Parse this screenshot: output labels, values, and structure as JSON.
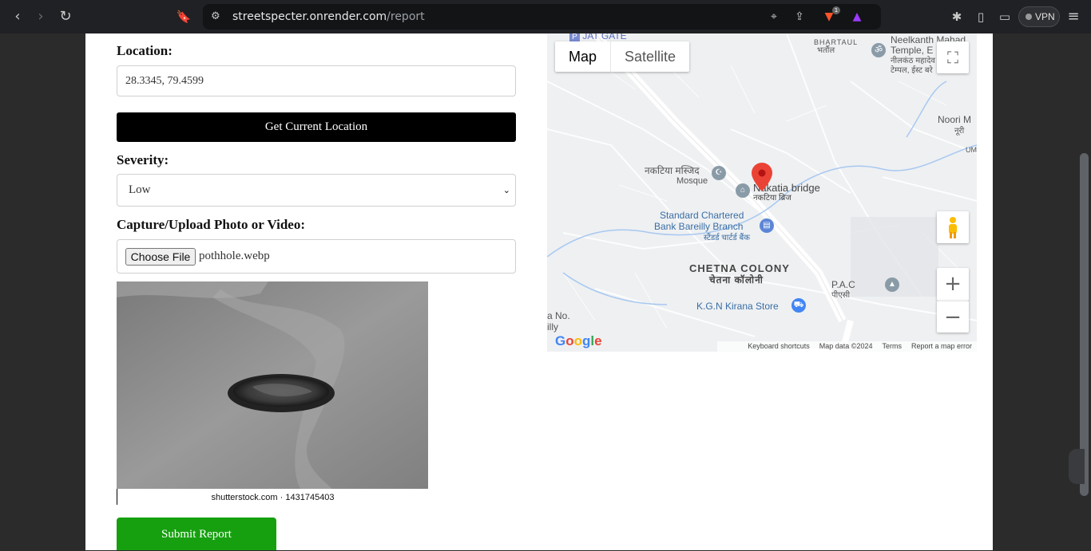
{
  "browser": {
    "url_host": "streetspecter.onrender.com",
    "url_path": "/report",
    "vpn_label": "VPN",
    "brave_badge": "1"
  },
  "form": {
    "location_label": "Location:",
    "location_value": "28.3345, 79.4599",
    "get_location_label": "Get Current Location",
    "severity_label": "Severity:",
    "severity_value": "Low",
    "upload_label": "Capture/Upload Photo or Video:",
    "choose_file_label": "Choose File",
    "file_name": "pothhole.webp",
    "photo_caption": "shutterstock.com · 1431745403",
    "submit_label": "Submit Report"
  },
  "map": {
    "tabs": [
      {
        "label": "Map",
        "active": true
      },
      {
        "label": "Satellite",
        "active": false
      }
    ],
    "labels": {
      "jat_gate": "JAT GATE",
      "bhartaul": "BHARTAUL",
      "bhartaul_hi": "भर्तौल",
      "neelkanth_1": "Neelkanth Mahad",
      "neelkanth_2": "Temple, E",
      "neelkanth_hi_1": "नीलकंठ महादेव",
      "neelkanth_hi_2": "टेम्पल, ईस्ट बरे",
      "noori": "Noori M",
      "noori_hi": "नूरी",
      "um": "UM",
      "mosque_hi": "नकटिया मस्जिद",
      "mosque": "Mosque",
      "bridge": "Nakatia bridge",
      "bridge_hi": "नकटिया ब्रिज",
      "bank_1": "Standard Chartered",
      "bank_2": "Bank Bareilly Branch",
      "bank_hi": "स्टैंडर्ड चार्टर्ड बैंक",
      "chetna": "CHETNA COLONY",
      "chetna_hi": "चेतना कॉलोनी",
      "pac": "P.A.C",
      "pac_hi": "पीएसी",
      "kirana": "K.G.N Kirana Store",
      "left_1": "a No.",
      "left_2": "illy"
    },
    "google": "Google",
    "footer": [
      "Keyboard shortcuts",
      "Map data ©2024",
      "Terms",
      "Report a map error"
    ]
  },
  "colors": {
    "submit_green": "#16a00f",
    "pin_red": "#ea4335",
    "map_bg": "#eef0f2"
  }
}
